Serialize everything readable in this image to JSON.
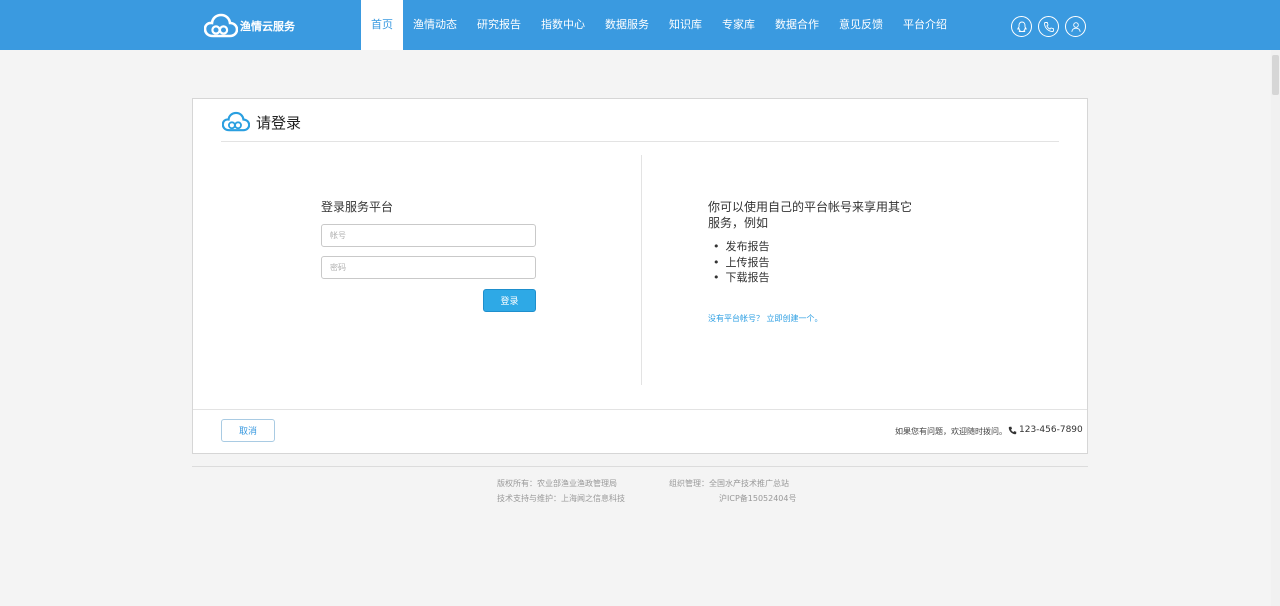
{
  "header": {
    "logo_text": "渔情云服务",
    "nav": [
      {
        "label": "首页",
        "active": true
      },
      {
        "label": "渔情动态",
        "active": false
      },
      {
        "label": "研究报告",
        "active": false
      },
      {
        "label": "指数中心",
        "active": false
      },
      {
        "label": "数据服务",
        "active": false
      },
      {
        "label": "知识库",
        "active": false
      },
      {
        "label": "专家库",
        "active": false
      },
      {
        "label": "数据合作",
        "active": false
      },
      {
        "label": "意见反馈",
        "active": false
      },
      {
        "label": "平台介绍",
        "active": false
      }
    ],
    "icons": [
      "qq-icon",
      "phone-icon",
      "user-icon"
    ],
    "bg_color": "#3a9ae0"
  },
  "panel": {
    "title": "请登录",
    "form": {
      "title": "登录服务平台",
      "account_placeholder": "帐号",
      "password_placeholder": "密码",
      "login_label": "登录"
    },
    "info": {
      "title": "你可以使用自己的平台帐号来享用其它服务，例如",
      "items": [
        "发布报告",
        "上传报告",
        "下载报告"
      ],
      "signup_link": "没有平台帐号？ 立即创建一个。"
    },
    "footer": {
      "cancel_label": "取消",
      "help_text": "如果您有问题，欢迎随时拨问。",
      "phone": "123-456-7890"
    }
  },
  "page_footer": {
    "copyright": "版权所有：农业部渔业渔政管理局",
    "organizer": "组织管理：全国水产技术推广总站",
    "support": "技术支持与维护：上海闻之信息科技",
    "icp": "沪ICP备15052404号"
  },
  "colors": {
    "accent": "#3a9ae0",
    "button": "#2ea9e6",
    "link": "#2d9fe3"
  }
}
